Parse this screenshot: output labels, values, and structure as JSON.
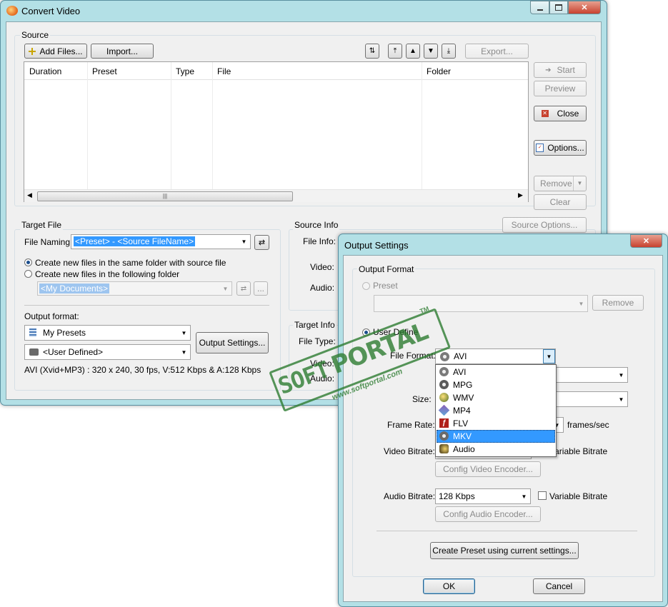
{
  "main_window": {
    "title": "Convert Video",
    "source_group": "Source",
    "toolbar": {
      "add_files": "Add Files...",
      "import": "Import...",
      "export": "Export..."
    },
    "table": {
      "columns": [
        "Duration",
        "Preset",
        "Type",
        "File",
        "Folder"
      ],
      "scroll_grip": "|||"
    },
    "side_buttons": {
      "start": "Start",
      "preview": "Preview",
      "close": "Close",
      "options": "Options...",
      "remove": "Remove",
      "clear": "Clear"
    },
    "target_file": {
      "group": "Target File",
      "file_naming_label": "File Naming:",
      "file_naming_value": "<Preset> - <Source FileName>",
      "radio_same_folder": "Create new files in the same folder with source file",
      "radio_following_folder": "Create new files in the following folder",
      "folder_value": "<My Documents>",
      "folder_browse": "...",
      "output_format_label": "Output format:",
      "preset_group_value": "My Presets",
      "preset_value": "<User Defined>",
      "output_settings_button": "Output Settings...",
      "summary": "AVI (Xvid+MP3) : 320 x 240, 30 fps, V:512 Kbps & A:128 Kbps"
    },
    "source_info": {
      "group": "Source Info",
      "source_options_button": "Source Options...",
      "file_info_label": "File Info:",
      "video_label": "Video:",
      "audio_label": "Audio:"
    },
    "target_info": {
      "group": "Target Info",
      "file_type_label": "File Type:",
      "video_label": "Video:",
      "audio_label": "Audio:"
    }
  },
  "dialog": {
    "title": "Output Settings",
    "output_format_group": "Output Format",
    "preset_radio": "Preset",
    "remove_button": "Remove",
    "user_define_radio": "User Define",
    "file_format_label": "File Format:",
    "file_format_value": "AVI",
    "format_options": [
      {
        "label": "AVI",
        "icon": "film-reel-icon"
      },
      {
        "label": "MPG",
        "icon": "film-reel-icon"
      },
      {
        "label": "WMV",
        "icon": "windows-media-icon"
      },
      {
        "label": "MP4",
        "icon": "mp4-film-icon"
      },
      {
        "label": "FLV",
        "icon": "flash-icon"
      },
      {
        "label": "MKV",
        "icon": "film-reel-icon"
      },
      {
        "label": "Audio",
        "icon": "speaker-icon"
      }
    ],
    "highlighted_option": "MKV",
    "size_label": "Size:",
    "frame_rate_label": "Frame Rate:",
    "frame_rate_unit": "frames/sec",
    "video_bitrate_label": "Video Bitrate:",
    "variable_bitrate_video": "Variable Bitrate",
    "config_video_encoder": "Config Video Encoder...",
    "audio_bitrate_label": "Audio Bitrate:",
    "audio_bitrate_value": "128 Kbps",
    "variable_bitrate_audio": "Variable Bitrate",
    "config_audio_encoder": "Config Audio Encoder...",
    "create_preset_button": "Create Preset using current settings...",
    "ok_button": "OK",
    "cancel_button": "Cancel"
  },
  "watermark": {
    "text_left": "SOFT",
    "text_right": "PORTAL",
    "tm": "TM",
    "url": "www.softportal.com"
  },
  "colors": {
    "titlebar": "#b3e0e6",
    "selection": "#3399ff",
    "watermark": "#2e7d32",
    "close_red": "#c7422f"
  }
}
